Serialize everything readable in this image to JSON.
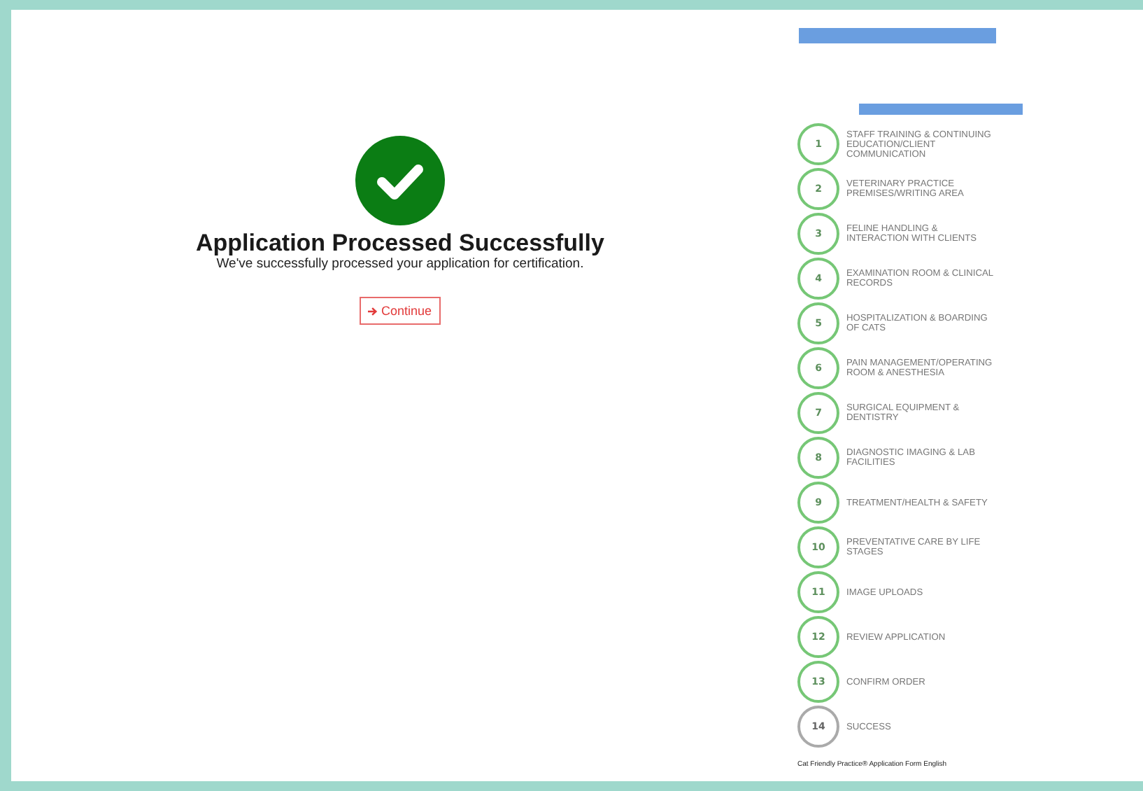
{
  "result": {
    "title": "Application Processed Successfully",
    "message": "We've successfully processed your application for certification.",
    "button": "Continue"
  },
  "steps": [
    {
      "number": "1",
      "label": "STAFF TRAINING & CONTINUING EDUCATION/CLIENT COMMUNICATION",
      "completed": true
    },
    {
      "number": "2",
      "label": "VETERINARY PRACTICE PREMISES/WRITING AREA",
      "completed": true
    },
    {
      "number": "3",
      "label": "FELINE HANDLING & INTERACTION WITH CLIENTS",
      "completed": true
    },
    {
      "number": "4",
      "label": "EXAMINATION ROOM & CLINICAL RECORDS",
      "completed": true
    },
    {
      "number": "5",
      "label": "HOSPITALIZATION & BOARDING OF CATS",
      "completed": true
    },
    {
      "number": "6",
      "label": "PAIN MANAGEMENT/OPERATING ROOM & ANESTHESIA",
      "completed": true
    },
    {
      "number": "7",
      "label": "SURGICAL EQUIPMENT & DENTISTRY",
      "completed": true
    },
    {
      "number": "8",
      "label": "DIAGNOSTIC IMAGING & LAB FACILITIES",
      "completed": true
    },
    {
      "number": "9",
      "label": "TREATMENT/HEALTH & SAFETY",
      "completed": true
    },
    {
      "number": "10",
      "label": "PREVENTATIVE CARE BY LIFE STAGES",
      "completed": true
    },
    {
      "number": "11",
      "label": "IMAGE UPLOADS",
      "completed": true
    },
    {
      "number": "12",
      "label": "REVIEW APPLICATION",
      "completed": true
    },
    {
      "number": "13",
      "label": "CONFIRM ORDER",
      "completed": true
    },
    {
      "number": "14",
      "label": "SUCCESS",
      "completed": false
    }
  ],
  "footer": "Cat Friendly Practice® Application Form English"
}
